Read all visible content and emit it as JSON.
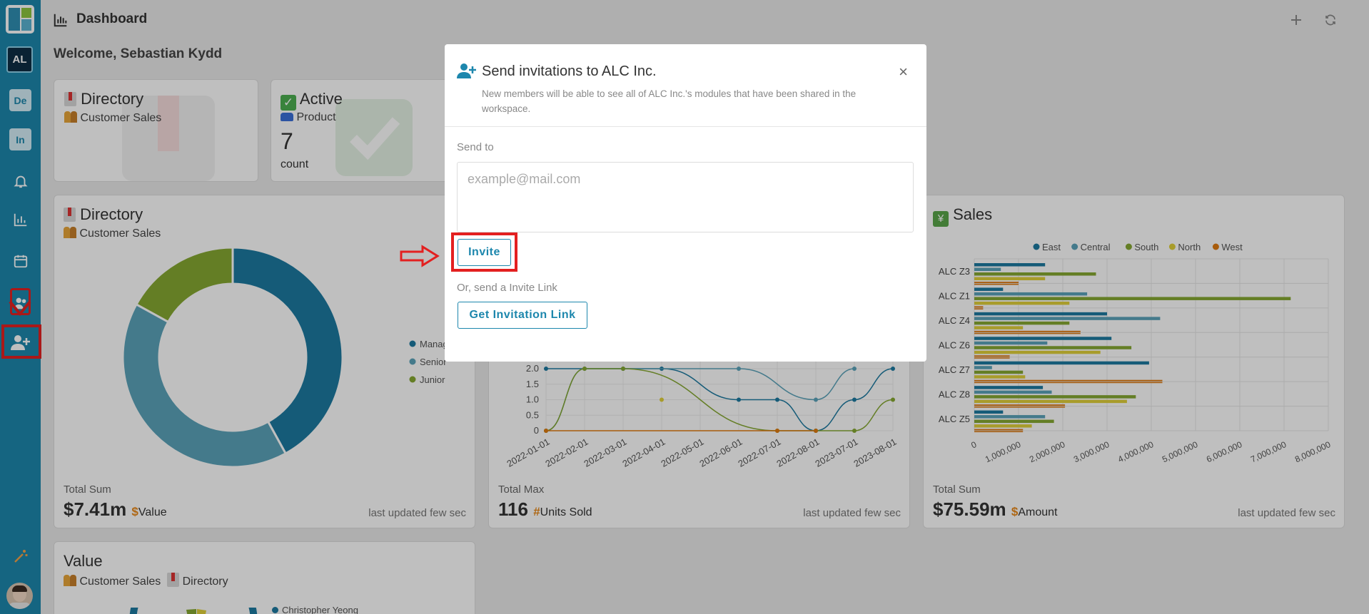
{
  "header": {
    "title": "Dashboard",
    "welcome": "Welcome, Sebastian Kydd"
  },
  "sidebar": {
    "workspaces": [
      {
        "label": "AL"
      },
      {
        "label": "De"
      },
      {
        "label": "In"
      }
    ],
    "icons": [
      "bell-icon",
      "chart-icon",
      "calendar-icon",
      "team-icon",
      "add-user-icon",
      "wand-icon",
      "avatar"
    ]
  },
  "cards": {
    "directory_small": {
      "title": "Directory",
      "subtitle": "Customer Sales"
    },
    "active": {
      "title": "Active",
      "subtitle": "Product",
      "value": "7",
      "unit": "count"
    },
    "directory_pie": {
      "title": "Directory",
      "subtitle": "Customer Sales",
      "foot_label": "Total Sum",
      "foot_value": "$7.41m",
      "foot_symbol": "$",
      "foot_unit": "Value",
      "updated": "last updated few sec"
    },
    "line": {
      "foot_label": "Total Max",
      "foot_value": "116",
      "foot_symbol": "#",
      "foot_unit": "Units Sold",
      "updated": "last updated few sec"
    },
    "sales": {
      "title": "Sales",
      "foot_label": "Total Sum",
      "foot_value": "$75.59m",
      "foot_symbol": "$",
      "foot_unit": "Amount",
      "updated": "last updated few sec"
    },
    "value": {
      "title": "Value",
      "subtitle": "Customer Sales",
      "subtitle2": "Directory",
      "legend_first": "Christopher Yeong"
    }
  },
  "modal": {
    "title": "Send invitations to ALC Inc.",
    "description": "New members will be able to see all of ALC Inc.'s modules that have been shared in the workspace.",
    "close": "×",
    "send_to_label": "Send to",
    "email_placeholder": "example@mail.com",
    "email_value": "",
    "invite_label": "Invite",
    "or_text": "Or, send a Invite Link",
    "link_label": "Get Invitation Link"
  },
  "colors": {
    "primary": "#1d87ad",
    "sidebar": "#1d87ad",
    "highlight": "#e32020",
    "series": [
      "#1d7aa0",
      "#5ba3ba",
      "#86a832",
      "#e0d03a",
      "#e07b10"
    ]
  },
  "chart_data": [
    {
      "type": "pie",
      "categories": [
        "Manag",
        "Senior",
        "Junior"
      ],
      "values": [
        42,
        41,
        17
      ]
    },
    {
      "type": "line",
      "x": [
        "2022-01-01",
        "2022-02-01",
        "2022-03-01",
        "2022-04-01",
        "2022-05-01",
        "2022-06-01",
        "2022-07-01",
        "2022-08-01",
        "2023-07-01",
        "2023-08-01"
      ],
      "yticks": [
        "0",
        "0.5",
        "1.0",
        "1.5",
        "2.0"
      ],
      "series": [
        {
          "values": [
            2.0,
            null,
            2.0,
            2.0,
            null,
            1.0,
            1.0,
            0,
            1.0,
            2.0
          ]
        },
        {
          "values": [
            0,
            2.0,
            null,
            null,
            null,
            2.0,
            null,
            1.0,
            2.0,
            null
          ]
        },
        {
          "values": [
            0,
            2.0,
            2.0,
            null,
            null,
            null,
            0,
            0,
            0,
            1.0
          ]
        },
        {
          "values": [
            null,
            null,
            null,
            1.0,
            null,
            null,
            null,
            null,
            null,
            null
          ]
        },
        {
          "values": [
            0,
            null,
            null,
            null,
            null,
            null,
            0,
            0,
            null,
            null
          ]
        }
      ]
    },
    {
      "type": "bar",
      "orientation": "horizontal",
      "categories": [
        "ALC Z3",
        "ALC Z1",
        "ALC Z4",
        "ALC Z6",
        "ALC Z7",
        "ALC Z8",
        "ALC Z5"
      ],
      "series": [
        {
          "name": "East",
          "values": [
            1600000,
            650000,
            3000000,
            3100000,
            3950000,
            1550000,
            650000
          ]
        },
        {
          "name": "Central",
          "values": [
            600000,
            2550000,
            4200000,
            1650000,
            400000,
            1750000,
            1600000
          ]
        },
        {
          "name": "South",
          "values": [
            2750000,
            7150000,
            2150000,
            3550000,
            1100000,
            3650000,
            1800000
          ]
        },
        {
          "name": "North",
          "values": [
            1600000,
            2150000,
            1100000,
            2850000,
            1150000,
            3450000,
            1300000
          ]
        },
        {
          "name": "West",
          "values": [
            1000000,
            200000,
            2400000,
            800000,
            4250000,
            2050000,
            1100000
          ]
        }
      ],
      "xticks": [
        "0",
        "1,000,000",
        "2,000,000",
        "3,000,000",
        "4,000,000",
        "5,000,000",
        "6,000,000",
        "7,000,000",
        "8,000,000"
      ],
      "xlim": [
        0,
        8000000
      ],
      "legend": "top"
    }
  ]
}
